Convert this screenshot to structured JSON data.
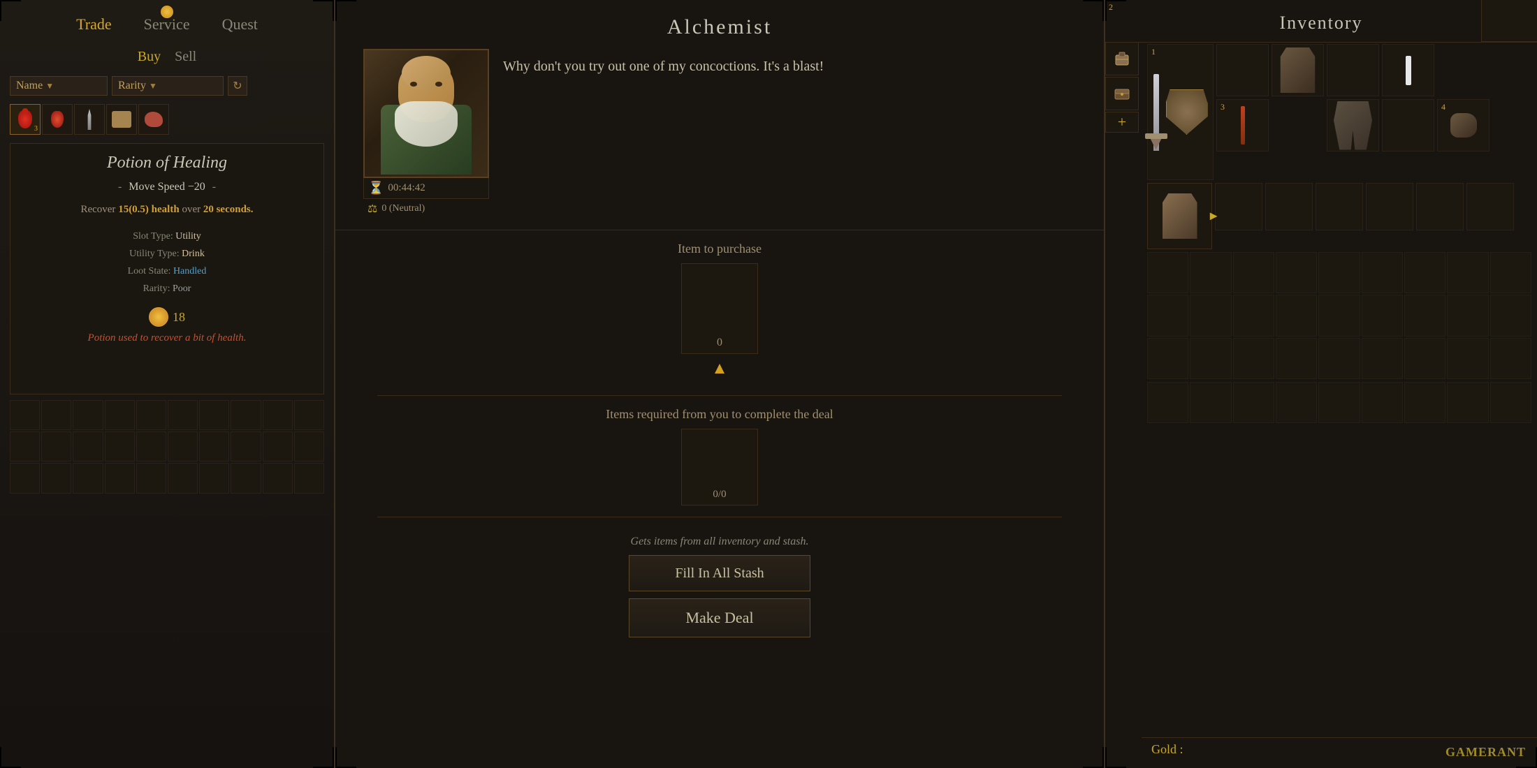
{
  "left_panel": {
    "nav_tabs": {
      "trade": "Trade",
      "service": "Service",
      "quest": "Quest",
      "active": "Trade"
    },
    "buy_sell": {
      "buy": "Buy",
      "sell": "Sell",
      "active": "Buy"
    },
    "filters": {
      "name_label": "Name",
      "rarity_label": "Rarity"
    },
    "item": {
      "name": "Potion of Healing",
      "stat_label": "Move Speed −20",
      "description_part1": "Recover ",
      "description_highlight1": "15(0.5) health",
      "description_part2": " over ",
      "description_highlight2": "20 seconds.",
      "slot_type_label": "Slot Type:",
      "slot_type_val": "Utility",
      "utility_type_label": "Utility Type:",
      "utility_type_val": "Drink",
      "loot_state_label": "Loot State:",
      "loot_state_val": "Handled",
      "rarity_label": "Rarity:",
      "rarity_val": "Poor",
      "gold_amount": "18",
      "flavor_text": "Potion used to recover a bit of health."
    }
  },
  "center_panel": {
    "title": "Alchemist",
    "dialogue": "Why don't you try out one of my concoctions. It's a blast!",
    "reputation_value": "0 (Neutral)",
    "timer": "00:44:42",
    "item_to_purchase_label": "Item to purchase",
    "item_count": "0",
    "required_label": "Items required from you to complete the deal",
    "required_count": "0/0",
    "gets_items_text": "Gets items from all inventory and stash.",
    "fill_stash_btn": "Fill In All Stash",
    "make_deal_btn": "Make Deal"
  },
  "right_panel": {
    "title": "Inventory",
    "gold_label": "Gold :",
    "slot_numbers": [
      "1",
      "2",
      "3",
      "4"
    ],
    "watermark": "GAMERANT"
  }
}
